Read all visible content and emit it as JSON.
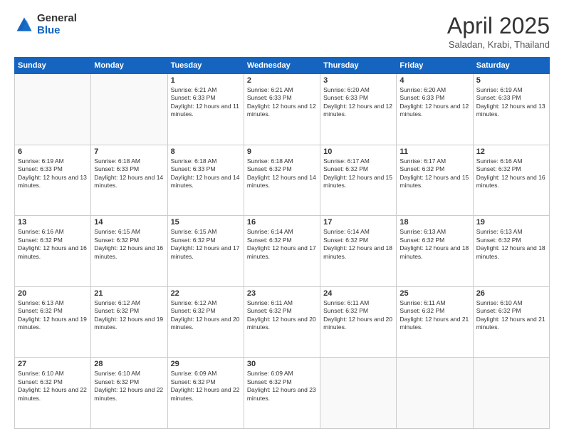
{
  "logo": {
    "general": "General",
    "blue": "Blue"
  },
  "title": "April 2025",
  "subtitle": "Saladan, Krabi, Thailand",
  "days_of_week": [
    "Sunday",
    "Monday",
    "Tuesday",
    "Wednesday",
    "Thursday",
    "Friday",
    "Saturday"
  ],
  "weeks": [
    [
      {
        "day": "",
        "info": ""
      },
      {
        "day": "",
        "info": ""
      },
      {
        "day": "1",
        "info": "Sunrise: 6:21 AM\nSunset: 6:33 PM\nDaylight: 12 hours and 11 minutes."
      },
      {
        "day": "2",
        "info": "Sunrise: 6:21 AM\nSunset: 6:33 PM\nDaylight: 12 hours and 12 minutes."
      },
      {
        "day": "3",
        "info": "Sunrise: 6:20 AM\nSunset: 6:33 PM\nDaylight: 12 hours and 12 minutes."
      },
      {
        "day": "4",
        "info": "Sunrise: 6:20 AM\nSunset: 6:33 PM\nDaylight: 12 hours and 12 minutes."
      },
      {
        "day": "5",
        "info": "Sunrise: 6:19 AM\nSunset: 6:33 PM\nDaylight: 12 hours and 13 minutes."
      }
    ],
    [
      {
        "day": "6",
        "info": "Sunrise: 6:19 AM\nSunset: 6:33 PM\nDaylight: 12 hours and 13 minutes."
      },
      {
        "day": "7",
        "info": "Sunrise: 6:18 AM\nSunset: 6:33 PM\nDaylight: 12 hours and 14 minutes."
      },
      {
        "day": "8",
        "info": "Sunrise: 6:18 AM\nSunset: 6:33 PM\nDaylight: 12 hours and 14 minutes."
      },
      {
        "day": "9",
        "info": "Sunrise: 6:18 AM\nSunset: 6:32 PM\nDaylight: 12 hours and 14 minutes."
      },
      {
        "day": "10",
        "info": "Sunrise: 6:17 AM\nSunset: 6:32 PM\nDaylight: 12 hours and 15 minutes."
      },
      {
        "day": "11",
        "info": "Sunrise: 6:17 AM\nSunset: 6:32 PM\nDaylight: 12 hours and 15 minutes."
      },
      {
        "day": "12",
        "info": "Sunrise: 6:16 AM\nSunset: 6:32 PM\nDaylight: 12 hours and 16 minutes."
      }
    ],
    [
      {
        "day": "13",
        "info": "Sunrise: 6:16 AM\nSunset: 6:32 PM\nDaylight: 12 hours and 16 minutes."
      },
      {
        "day": "14",
        "info": "Sunrise: 6:15 AM\nSunset: 6:32 PM\nDaylight: 12 hours and 16 minutes."
      },
      {
        "day": "15",
        "info": "Sunrise: 6:15 AM\nSunset: 6:32 PM\nDaylight: 12 hours and 17 minutes."
      },
      {
        "day": "16",
        "info": "Sunrise: 6:14 AM\nSunset: 6:32 PM\nDaylight: 12 hours and 17 minutes."
      },
      {
        "day": "17",
        "info": "Sunrise: 6:14 AM\nSunset: 6:32 PM\nDaylight: 12 hours and 18 minutes."
      },
      {
        "day": "18",
        "info": "Sunrise: 6:13 AM\nSunset: 6:32 PM\nDaylight: 12 hours and 18 minutes."
      },
      {
        "day": "19",
        "info": "Sunrise: 6:13 AM\nSunset: 6:32 PM\nDaylight: 12 hours and 18 minutes."
      }
    ],
    [
      {
        "day": "20",
        "info": "Sunrise: 6:13 AM\nSunset: 6:32 PM\nDaylight: 12 hours and 19 minutes."
      },
      {
        "day": "21",
        "info": "Sunrise: 6:12 AM\nSunset: 6:32 PM\nDaylight: 12 hours and 19 minutes."
      },
      {
        "day": "22",
        "info": "Sunrise: 6:12 AM\nSunset: 6:32 PM\nDaylight: 12 hours and 20 minutes."
      },
      {
        "day": "23",
        "info": "Sunrise: 6:11 AM\nSunset: 6:32 PM\nDaylight: 12 hours and 20 minutes."
      },
      {
        "day": "24",
        "info": "Sunrise: 6:11 AM\nSunset: 6:32 PM\nDaylight: 12 hours and 20 minutes."
      },
      {
        "day": "25",
        "info": "Sunrise: 6:11 AM\nSunset: 6:32 PM\nDaylight: 12 hours and 21 minutes."
      },
      {
        "day": "26",
        "info": "Sunrise: 6:10 AM\nSunset: 6:32 PM\nDaylight: 12 hours and 21 minutes."
      }
    ],
    [
      {
        "day": "27",
        "info": "Sunrise: 6:10 AM\nSunset: 6:32 PM\nDaylight: 12 hours and 22 minutes."
      },
      {
        "day": "28",
        "info": "Sunrise: 6:10 AM\nSunset: 6:32 PM\nDaylight: 12 hours and 22 minutes."
      },
      {
        "day": "29",
        "info": "Sunrise: 6:09 AM\nSunset: 6:32 PM\nDaylight: 12 hours and 22 minutes."
      },
      {
        "day": "30",
        "info": "Sunrise: 6:09 AM\nSunset: 6:32 PM\nDaylight: 12 hours and 23 minutes."
      },
      {
        "day": "",
        "info": ""
      },
      {
        "day": "",
        "info": ""
      },
      {
        "day": "",
        "info": ""
      }
    ]
  ]
}
